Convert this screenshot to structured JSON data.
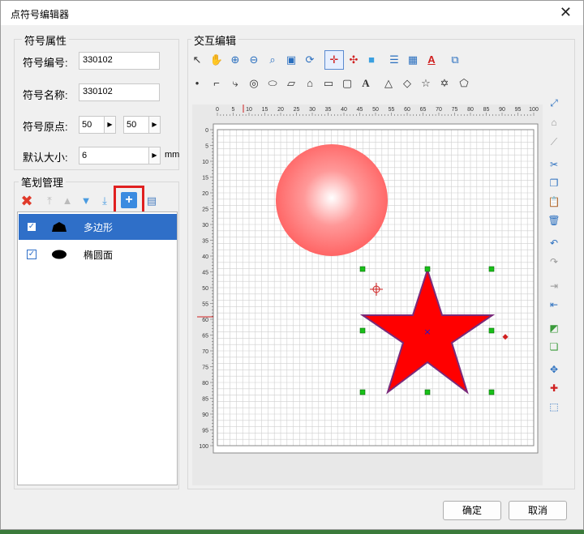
{
  "window": {
    "title": "点符号编辑器",
    "close": "✕"
  },
  "props": {
    "group_title": "符号属性",
    "code_label": "符号编号:",
    "code_value": "330102",
    "name_label": "符号名称:",
    "name_value": "330102",
    "origin_label": "符号原点:",
    "origin_x": "50",
    "origin_y": "50",
    "size_label": "默认大小:",
    "size_value": "6",
    "size_unit": "mm"
  },
  "strokes": {
    "group_title": "笔划管理",
    "items": [
      {
        "label": "多边形",
        "checked": true,
        "selected": true
      },
      {
        "label": "椭圆面",
        "checked": true,
        "selected": false
      }
    ]
  },
  "editor": {
    "group_title": "交互编辑",
    "ruler_ticks": [
      "0",
      "5",
      "10",
      "15",
      "20",
      "25",
      "30",
      "35",
      "40",
      "45",
      "50",
      "55",
      "60",
      "65",
      "70",
      "75",
      "80",
      "85",
      "90",
      "95",
      "100"
    ]
  },
  "buttons": {
    "ok": "确定",
    "cancel": "取消"
  },
  "colors": {
    "accent": "#2f6fc8",
    "star": "#ff0000",
    "highlight_box": "#e02020"
  }
}
